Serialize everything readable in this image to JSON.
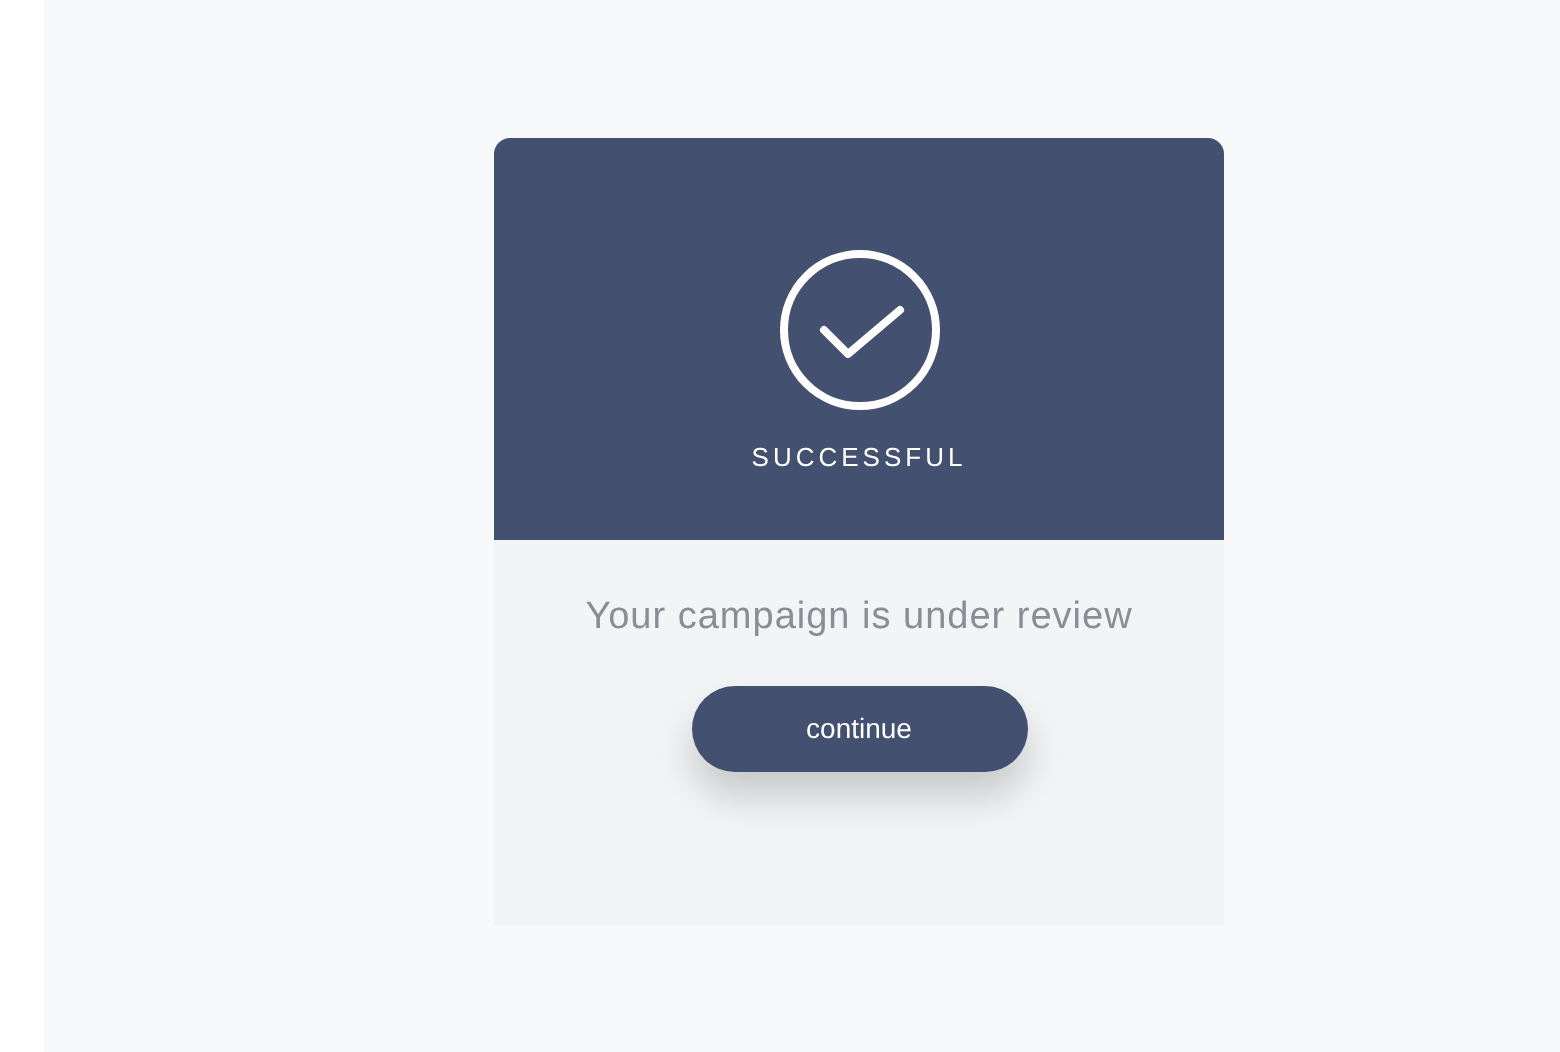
{
  "dialog": {
    "status": "SUCCESSFUL",
    "message": "Your campaign is under review",
    "button": "continue"
  }
}
